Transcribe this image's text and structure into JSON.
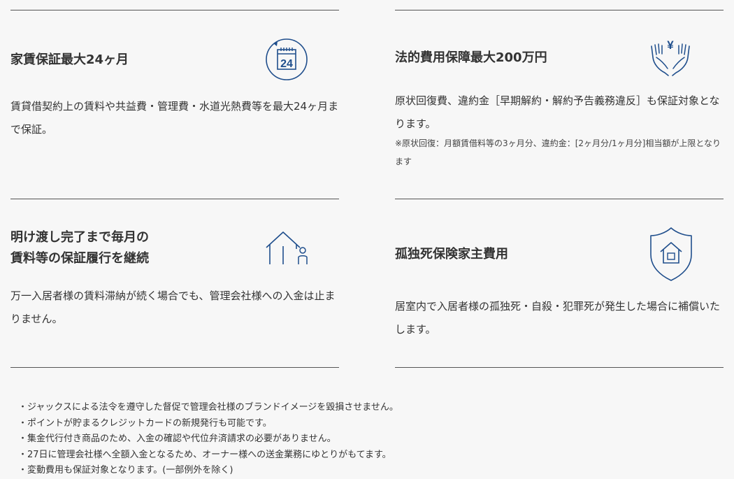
{
  "cards": [
    {
      "title": "家賃保証最大24ヶ月",
      "body": "賃貸借契約上の賃料や共益費・管理費・水道光熱費等を最大24ヶ月まで保証。",
      "icon": "calendar-24-icon",
      "icon_text": "24"
    },
    {
      "title": "法的費用保障最大200万円",
      "body": "原状回復費、違約金［早期解約・解約予告義務違反］も保証対象となります。",
      "note": "※原状回復：月額賃借料等の3ヶ月分、違約金：[2ヶ月分/1ヶ月分]相当額が上限となります",
      "icon": "hands-yen-icon",
      "icon_text": "¥"
    },
    {
      "title": "明け渡し完了まで毎月の\n賃料等の保証履行を継続",
      "body": "万一入居者様の賃料滞納が続く場合でも、管理会社様への入金は止まりません。",
      "icon": "house-person-icon"
    },
    {
      "title": "孤独死保険家主費用",
      "body": "居室内で入居者様の孤独死・自殺・犯罪死が発生した場合に補償いたします。",
      "icon": "shield-house-icon"
    }
  ],
  "notes": [
    "・ジャックスによる法令を遵守した督促で管理会社様のブランドイメージを毀損させません。",
    "・ポイントが貯まるクレジットカードの新規発行も可能です。",
    "・集金代行付き商品のため、入金の確認や代位弁済請求の必要がありません。",
    "・27日に管理会社様へ全額入金となるため、オーナー様への送金業務にゆとりがもてます。",
    "・変動費用も保証対象となります。(一部例外を除く)"
  ],
  "colors": {
    "accent": "#1f4e8c",
    "line": "#555555",
    "text": "#333333"
  }
}
